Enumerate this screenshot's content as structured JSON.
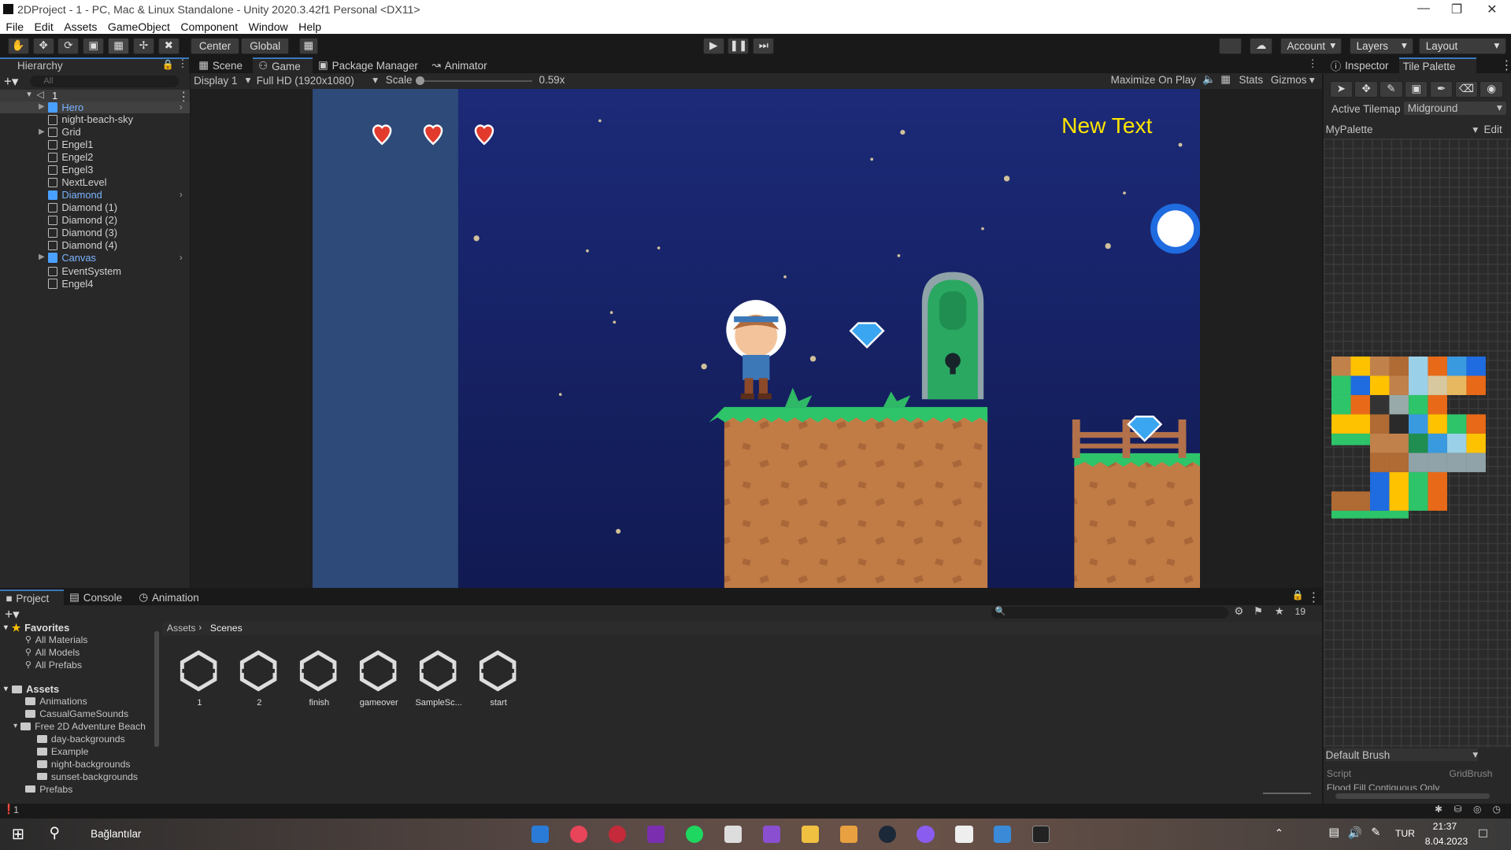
{
  "window": {
    "title": "2DProject - 1 - PC, Mac & Linux Standalone - Unity 2020.3.42f1 Personal <DX11>"
  },
  "menu": [
    "File",
    "Edit",
    "Assets",
    "GameObject",
    "Component",
    "Window",
    "Help"
  ],
  "toolbar": {
    "center": "Center",
    "global": "Global",
    "account": "Account",
    "layers": "Layers",
    "layout": "Layout"
  },
  "hierarchy": {
    "tab": "Hierarchy",
    "search_placeholder": "All",
    "scene": "1",
    "items": [
      "Hero",
      "night-beach-sky",
      "Grid",
      "Engel1",
      "Engel2",
      "Engel3",
      "NextLevel",
      "Diamond",
      "Diamond (1)",
      "Diamond (2)",
      "Diamond (3)",
      "Diamond (4)",
      "Canvas",
      "EventSystem",
      "Engel4"
    ]
  },
  "center_tabs": [
    "Scene",
    "Game",
    "Package Manager",
    "Animator"
  ],
  "game_toolbar": {
    "display": "Display 1",
    "resolution": "Full HD (1920x1080)",
    "scale_label": "Scale",
    "scale_value": "0.59x",
    "maximize": "Maximize On Play",
    "stats": "Stats",
    "gizmos": "Gizmos"
  },
  "game": {
    "ui_text": "New Text",
    "hearts": 3
  },
  "inspector": {
    "tabs": [
      "Inspector",
      "Tile Palette"
    ],
    "active_tilemap_label": "Active Tilemap",
    "active_tilemap": "Midground",
    "palette": "MyPalette",
    "edit": "Edit",
    "brush": "Default Brush",
    "script_label": "Script",
    "script_value": "GridBrush",
    "flood": "Flood Fill Contiguous Only"
  },
  "project": {
    "tabs": [
      "Project",
      "Console",
      "Animation"
    ],
    "count": "19",
    "favorites_label": "Favorites",
    "favorites": [
      "All Materials",
      "All Models",
      "All Prefabs"
    ],
    "assets_label": "Assets",
    "folders": [
      "Animations",
      "CasualGameSounds",
      "Free 2D Adventure Beach"
    ],
    "subfolders": [
      "day-backgrounds",
      "Example",
      "night-backgrounds",
      "sunset-backgrounds"
    ],
    "more": [
      "Prefabs"
    ],
    "breadcrumb": [
      "Assets",
      "Scenes"
    ],
    "scenes": [
      "1",
      "2",
      "finish",
      "gameover",
      "SampleSc...",
      "start"
    ]
  },
  "status": {
    "text": "1"
  },
  "taskbar": {
    "search": "Bağlantılar",
    "lang": "TUR",
    "time": "21:37",
    "date": "8.04.2023"
  },
  "colors": {
    "accent": "#3a79bb",
    "sky_top": "#1c2a78",
    "sky_bottom": "#121b55",
    "left_strip": "#2e4a78",
    "text_yellow": "#ffe600"
  }
}
